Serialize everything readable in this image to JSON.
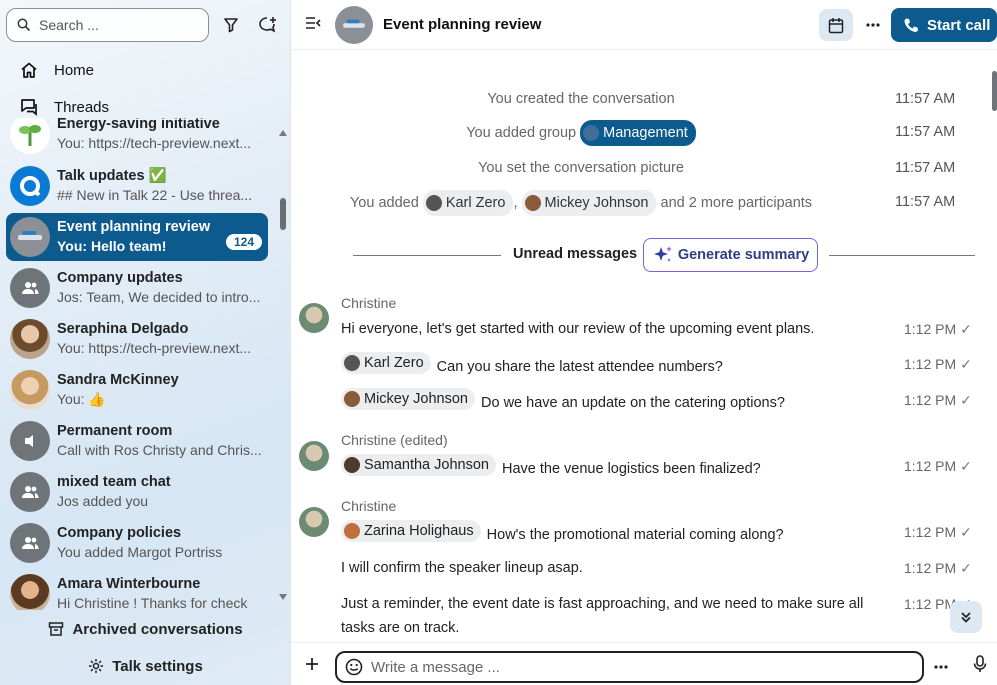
{
  "sidebar": {
    "search_placeholder": "Search ...",
    "nav": [
      {
        "label": "Home",
        "icon": "home-icon"
      },
      {
        "label": "Threads",
        "icon": "threads-icon"
      }
    ],
    "conversations": [
      {
        "name": "Energy-saving initiative",
        "sub": "You: https://tech-preview.next...",
        "avatar": "plant"
      },
      {
        "name": "Talk updates ✅",
        "sub": "## New in Talk 22 - Use threa...",
        "avatar": "talk"
      },
      {
        "name": "Event planning review",
        "sub": "You: Hello team!",
        "badge": "124",
        "active": true,
        "avatar": "event"
      },
      {
        "name": "Company updates",
        "sub": "Jos: Team, We decided to intro...",
        "avatar": "group"
      },
      {
        "name": "Seraphina Delgado",
        "sub": "You: https://tech-preview.next...",
        "avatar": "person"
      },
      {
        "name": "Sandra McKinney",
        "sub": "You: 👍",
        "avatar": "person"
      },
      {
        "name": "Permanent room",
        "sub": "Call with Ros Christy and Chris...",
        "avatar": "room"
      },
      {
        "name": "mixed team chat",
        "sub": "Jos added you",
        "avatar": "group"
      },
      {
        "name": "Company policies",
        "sub": "You added Margot Portriss",
        "avatar": "group"
      },
      {
        "name": "Amara Winterbourne",
        "sub": "Hi Christine ! Thanks for check",
        "avatar": "person"
      }
    ],
    "archived_label": "Archived conversations",
    "settings_label": "Talk settings"
  },
  "header": {
    "title": "Event planning review",
    "start_call_label": "Start call"
  },
  "system_messages": [
    {
      "text": "You created the conversation",
      "time": "11:57 AM"
    },
    {
      "prefix": "You added group",
      "chip": "Management",
      "time": "11:57 AM"
    },
    {
      "text": "You set the conversation picture",
      "time": "11:57 AM"
    },
    {
      "prefix": "You added",
      "chip1": "Karl Zero",
      "sep": ",",
      "chip2": "Mickey Johnson",
      "suffix": "and 2 more participants",
      "time": "11:57 AM"
    }
  ],
  "unread": {
    "label": "Unread messages",
    "summary_button": "Generate summary"
  },
  "messages": [
    {
      "author": "Christine",
      "text": "Hi everyone, let's get started with our review of the upcoming event plans.",
      "time": "1:12 PM"
    },
    {
      "mention": "Karl Zero",
      "text": "Can you share the latest attendee numbers?",
      "time": "1:12 PM"
    },
    {
      "mention": "Mickey Johnson",
      "text": "Do we have an update on the catering options?",
      "time": "1:12 PM"
    },
    {
      "author": "Christine (edited)",
      "mention": "Samantha Johnson",
      "text": "Have the venue logistics been finalized?",
      "time": "1:12 PM"
    },
    {
      "author": "Christine",
      "mention": "Zarina Holighaus",
      "text": "How's the promotional material coming along?",
      "time": "1:12 PM"
    },
    {
      "text": "I will confirm the speaker lineup asap.",
      "time": "1:12 PM"
    },
    {
      "text": "Just a reminder, the event date is fast approaching, and we need to make sure all tasks are on track.",
      "time": "1:12 PM"
    }
  ],
  "composer": {
    "placeholder": "Write a message ..."
  },
  "colors": {
    "accent": "#0d5a8f",
    "summary_border": "#7d5fe0"
  }
}
